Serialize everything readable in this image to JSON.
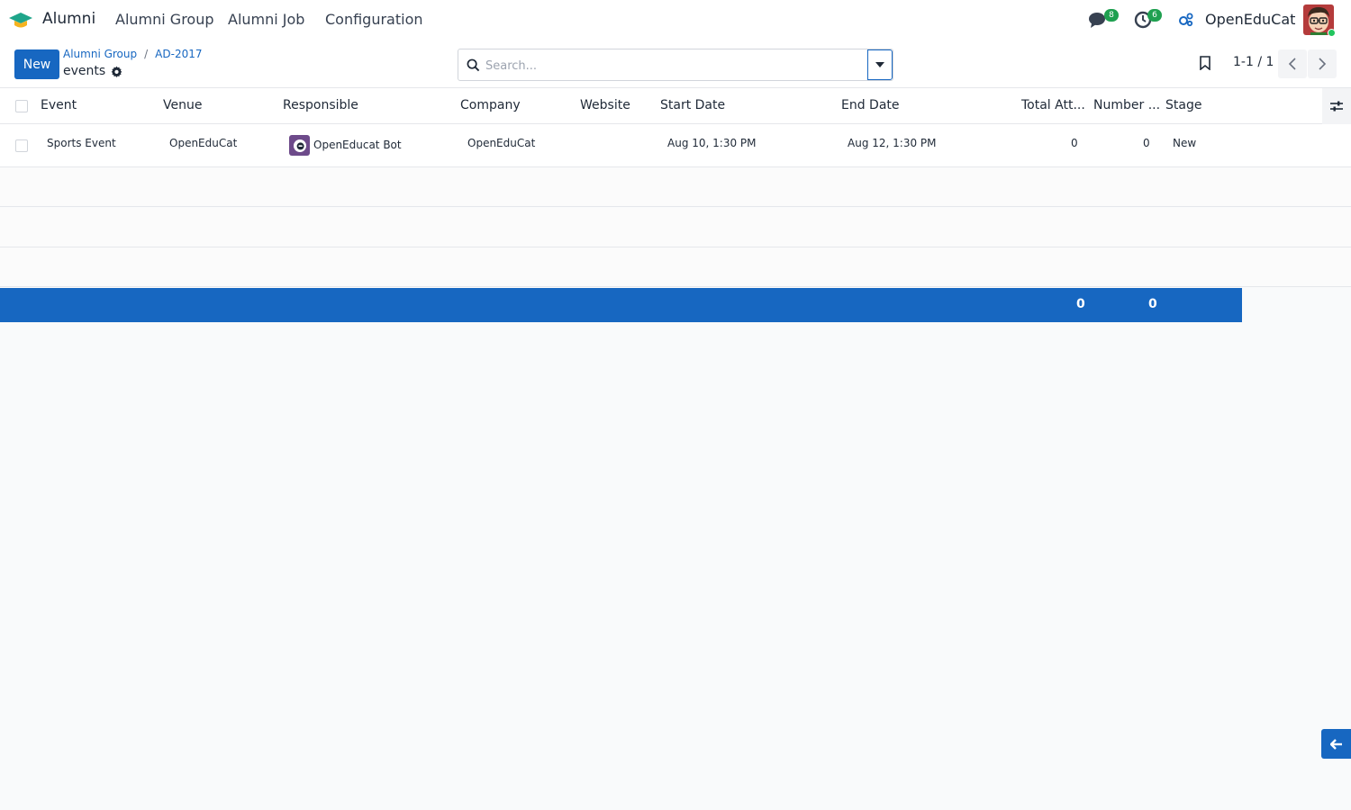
{
  "navbar": {
    "app_name": "Alumni",
    "menu": [
      "Alumni Group",
      "Alumni Job",
      "Configuration"
    ],
    "messages_count": "8",
    "activities_count": "6",
    "company": "OpenEduCat"
  },
  "control": {
    "new_label": "New",
    "breadcrumbs": [
      "Alumni Group",
      "AD-2017"
    ],
    "current": "events",
    "search_placeholder": "Search...",
    "pager": "1-1 / 1"
  },
  "table": {
    "columns": [
      "Event",
      "Venue",
      "Responsible",
      "Company",
      "Website",
      "Start Date",
      "End Date",
      "Total Att...",
      "Number ...",
      "Stage"
    ],
    "rows": [
      {
        "event": "Sports Event",
        "venue": "OpenEduCat",
        "responsible": "OpenEducat Bot",
        "company": "OpenEduCat",
        "website": "",
        "start_date": "Aug 10, 1:30 PM",
        "end_date": "Aug 12, 1:30 PM",
        "total_attendees": "0",
        "number": "0",
        "stage": "New"
      }
    ],
    "totals": {
      "total_attendees": "0",
      "number": "0"
    }
  },
  "colors": {
    "primary": "#1767c1",
    "badge": "#1fa050"
  }
}
